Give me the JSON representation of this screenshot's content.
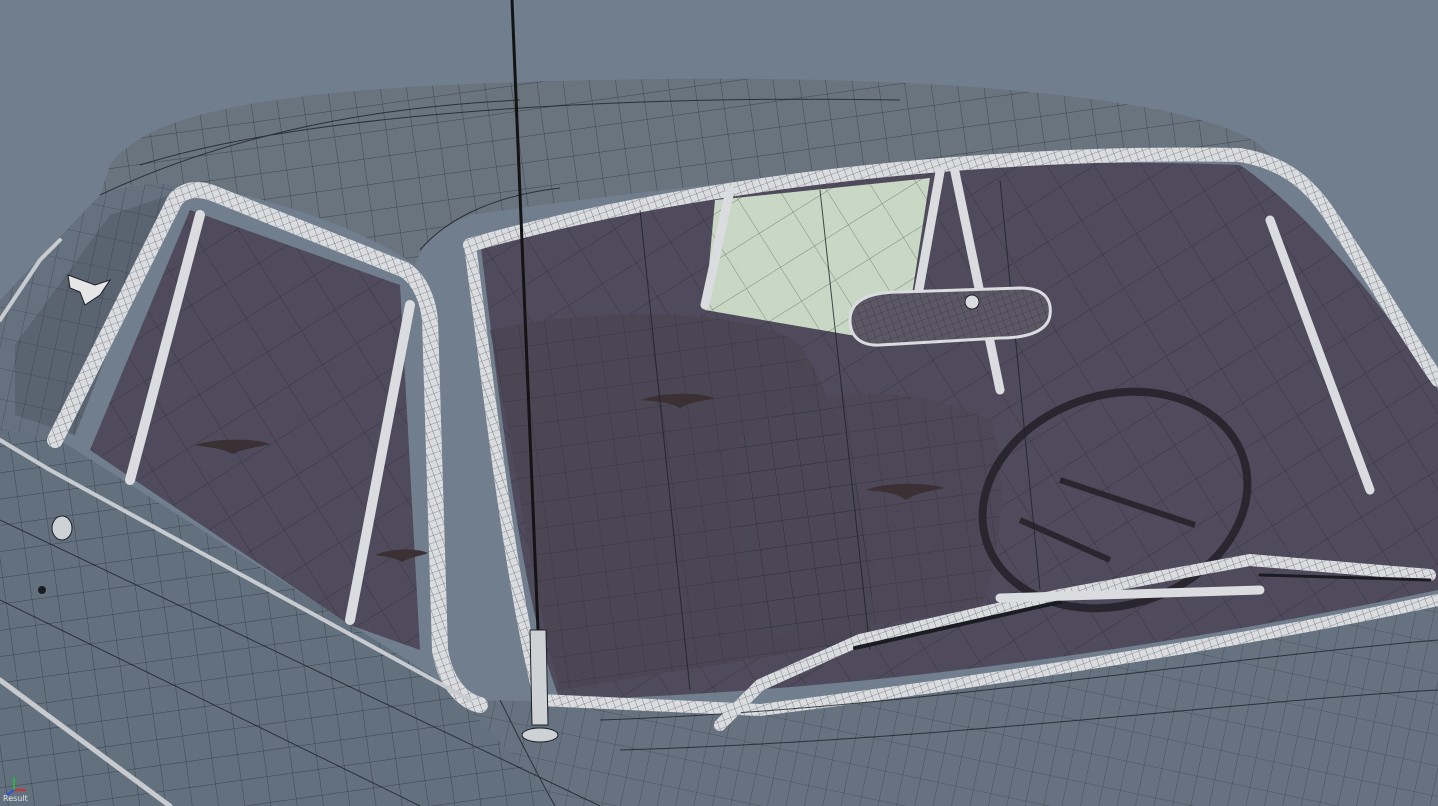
{
  "viewport": {
    "view_label": "Result",
    "background_color": "#707e8e",
    "display_mode": "wireframe-on-shaded",
    "subject": "hardtop-car-model"
  },
  "colors": {
    "body_surface": "#66717f",
    "wire": "#1c2129",
    "trim": "#dadcdf",
    "glass_tint": "#4f4b5c",
    "interior": "#4a4553",
    "rear_window_glow": "#c8d8c4",
    "emblem": "#3b3033"
  },
  "gizmo": {
    "axes": [
      "x-axis",
      "y-axis",
      "z-axis"
    ],
    "x_color": "#d03030",
    "y_color": "#30b040",
    "z_color": "#3050e0"
  }
}
